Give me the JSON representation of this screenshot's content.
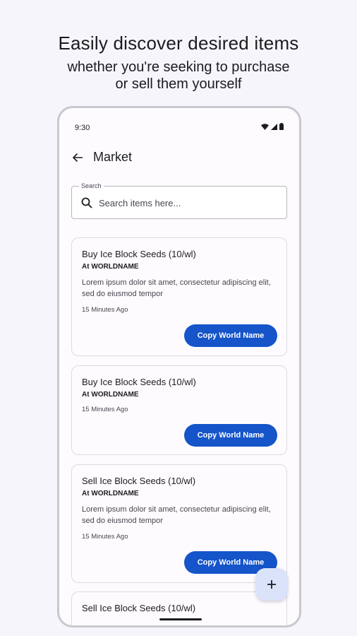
{
  "promo": {
    "headline": "Easily discover desired items",
    "subline_1": "whether you're seeking to purchase",
    "subline_2": "or sell them yourself"
  },
  "status_bar": {
    "time": "9:30",
    "icons": [
      "wifi-icon",
      "signal-icon",
      "battery-icon"
    ]
  },
  "app_bar": {
    "back_icon": "arrow-back-icon",
    "title": "Market"
  },
  "search": {
    "label": "Search",
    "placeholder": "Search items here...",
    "value": "",
    "icon": "search-icon"
  },
  "listings": [
    {
      "title": "Buy Ice Block Seeds (10/wl)",
      "world": "At WORLDNAME",
      "description": "Lorem ipsum dolor sit amet, consectetur adipiscing elit, sed do eiusmod tempor",
      "time": "15 Minutes Ago",
      "button": "Copy World Name"
    },
    {
      "title": "Buy Ice Block Seeds (10/wl)",
      "world": "At WORLDNAME",
      "description": "",
      "time": "15 Minutes Ago",
      "button": "Copy World Name"
    },
    {
      "title": "Sell Ice Block Seeds (10/wl)",
      "world": "At WORLDNAME",
      "description": "Lorem ipsum dolor sit amet, consectetur adipiscing elit, sed do eiusmod tempor",
      "time": "15 Minutes Ago",
      "button": "Copy World Name"
    },
    {
      "title": "Sell Ice Block Seeds (10/wl)"
    }
  ],
  "fab": {
    "icon": "add-icon",
    "label": "+"
  },
  "colors": {
    "background": "#f6f5fb",
    "primary_button": "#1554c9",
    "fab": "#dbe3fb",
    "card_border": "#dcdbe0"
  }
}
